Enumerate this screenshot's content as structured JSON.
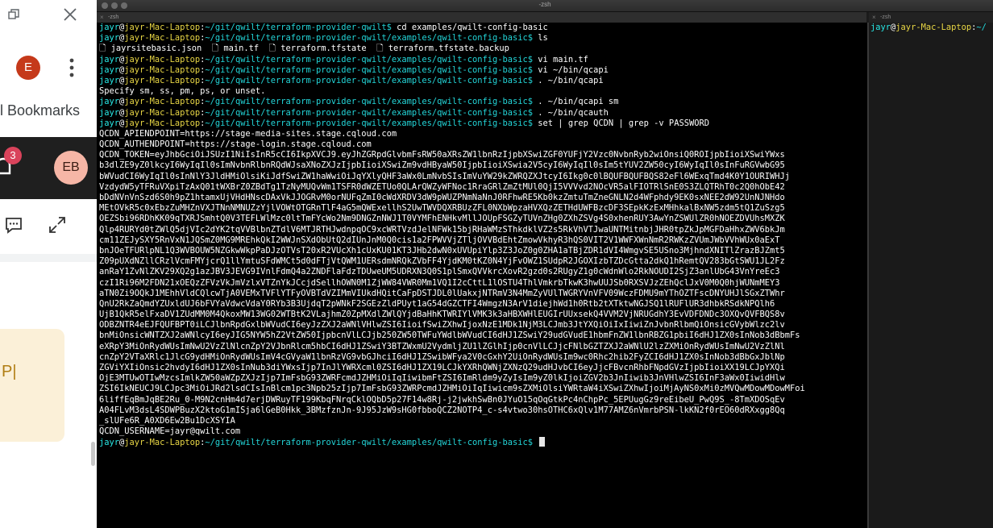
{
  "browser": {
    "avatar_letter": "E",
    "bookmarks_label": "ll Bookmarks",
    "notification_count": "3",
    "profile_initials": "EB",
    "notice_fragment": "P|"
  },
  "terminal": {
    "window_title": "-zsh",
    "tabs": [
      "-zsh",
      "-zsh"
    ],
    "prompt": {
      "user": "jayr",
      "at": "@",
      "host": "jayr-Mac-Laptop",
      "colon": ":"
    },
    "lines": [
      {
        "kind": "prompt",
        "path": "~/git/qwilt/terraform-provider-qwilt$",
        "cmd": " cd examples/qwilt-config-basic"
      },
      {
        "kind": "prompt",
        "path": "~/git/qwilt/terraform-provider-qwilt/examples/qwilt-config-basic$",
        "cmd": " ls"
      },
      {
        "kind": "out",
        "text": "🗋 jayrsitebasic.json  🗋 main.tf  🗋 terraform.tfstate  🗋 terraform.tfstate.backup"
      },
      {
        "kind": "prompt",
        "path": "~/git/qwilt/terraform-provider-qwilt/examples/qwilt-config-basic$",
        "cmd": " vi main.tf"
      },
      {
        "kind": "prompt",
        "path": "~/git/qwilt/terraform-provider-qwilt/examples/qwilt-config-basic$",
        "cmd": " vi ~/bin/qcapi"
      },
      {
        "kind": "prompt",
        "path": "~/git/qwilt/terraform-provider-qwilt/examples/qwilt-config-basic$",
        "cmd": " . ~/bin/qcapi"
      },
      {
        "kind": "out",
        "text": "Specify sm, ss, pm, ps, or unset."
      },
      {
        "kind": "prompt",
        "path": "~/git/qwilt/terraform-provider-qwilt/examples/qwilt-config-basic$",
        "cmd": " . ~/bin/qcapi sm"
      },
      {
        "kind": "prompt",
        "path": "~/git/qwilt/terraform-provider-qwilt/examples/qwilt-config-basic$",
        "cmd": " . ~/bin/qcauth"
      },
      {
        "kind": "prompt",
        "path": "~/git/qwilt/terraform-provider-qwilt/examples/qwilt-config-basic$",
        "cmd": " set | grep QCDN | grep -v PASSWORD"
      },
      {
        "kind": "out",
        "text": "QCDN_APIENDPOINT=https://stage-media-sites.stage.cqloud.com"
      },
      {
        "kind": "out",
        "text": "QCDN_AUTHENDPOINT=https://stage-login.stage.cqloud.com"
      },
      {
        "kind": "out",
        "text": "QCDN_TOKEN=eyJhbGciOiJSUzI1NiIsInR5cCI6IkpXVCJ9.eyJhZGRpdGlvbmFsRW50aXRsZW1lbnRzIjpbXSwiZGF0YUFjY2Vzc0NvbnRyb2wiOnsiQ0ROIjpbIioiXSwiYWxs"
      },
      {
        "kind": "out",
        "text": "b3dlZE9yZ0lkcyI6WyIqIl0sImNvbnRlbnRQdWJsaXNoZXJzIjpbIioiXSwiZm9vdHByaW50IjpbIioiXSwia2V5cyI6WyIqIl0sIm5tYUV2ZW50cyI6WyIqIl0sInFuRGVwbG95"
      },
      {
        "kind": "out",
        "text": "bWVudCI6WyIqIl0sInNlY3JldHMiOlsiKiJdfSwiZW1haWwiOiJqYXlyQHF3aWx0LmNvbSIsImVuYW29kZWRQZXJtcyI6Ikg0c0lBQUFBQUFBQS82eFl6WExqTmd4K0Y1OURIWHJj"
      },
      {
        "kind": "out",
        "text": "VzdydW5yTFRuVXpiTzAxQ01tWXBrZ0ZBdTg1TzNyMUQvWm1TSFR0dWZETUo0QLArQWZyWFNoc1RraGRlZmZtMUl0QjI5VVVvd2NOcVR5alFIOTRlSnE0S3ZLQTRhT0c2Q0hObE42"
      },
      {
        "kind": "out",
        "text": "bDdNVnVnSzd6S0h9pZ1htamxUjVHdHNscDAxVkJJOGRvM0orNUFqZmI0cWdXRDV3dW9pWUZPNmNaNnJ0RFhwRE5Kb0kzZmtuTmZneGNLN2d4WFphdy9EK0sxNEE2dW92UnNJNHdo"
      },
      {
        "kind": "out",
        "text": "MEtOVkR5c0xEbzZuMHZnVXJTNnNMNUZzYjlVOWtOTGRnTlF4aG5mQWExellhS2UwTWVDQXRBUzZFL0NXbWpzaHVXQzZETHdUWFBzcDF3SEpkKzExMHhkalBxNW5zdm5tQ1ZuSzg5"
      },
      {
        "kind": "out",
        "text": "OEZSbi96RDhKK09qTXRJSmhtQ0V3TEFLWlMzc0ltTmFYcWo2Nm9DNGZnNWJ1T0VYMFhENHkvMllJOUpFSGZyTUVnZHg0ZXhZSVg4S0xhenRUY3AwYnZSWUlZR0hNOEZDVUhsMXZK"
      },
      {
        "kind": "out",
        "text": "Qlp4RURYd0tZWlQ5djVIc2dYK2tqVVBlbnZTdlV6MTJRTHJwdnpqOC9xcWRTVzdJelNFWk15bjRHaWMzSThkdklVZ2s5RkVhVTJwaUNTMitnbjJHR0tpZkJpMGFDaHhxZWV6bkJm"
      },
      {
        "kind": "out",
        "text": "cm11ZEJySXY5RnVxN1JQSmZ0MG9MREhkQkI2WWJnSXdObUtQ2dIUnJnM0Q0cis1a2FPWVVjZTljOVVBdEhtZmowVkhyR3hQS0VIT2V1WWFXWnNmR2RWKzZVUmJWbVVhWUx0aExT"
      },
      {
        "kind": "out",
        "text": "bnJOeTFURlpNL1Q3WVBOUW5NZGkwWkpPaDJzOTVsT20xR2VUcXh1cUxKU01KT3JHb2dwN0xUVUpiYlp3Z3JoZ0g0ZHA1aTBjZDR1dVI4WmgvSE5USno3MjhndXNITlZrazBJZmt5"
      },
      {
        "kind": "out",
        "text": "Z09pUXdNZllCRzlVcmFMYjcrQ1llYmtuSFdWMCt5d0dFTjVtQWM1UERsdmNRQkZVbFF4YjdKM0tKZ0N4YjFvOWZ1SUdpR2JGOXIzbTZDcGtta2dkQ1hRemtQV283bGtSWU1JL2Fz"
      },
      {
        "kind": "out",
        "text": "anRaY1ZvNlZKV29XQ2g1azJBV3JEVG9IVnlFdmQ4a2ZNDFlaFdzTDUweUM5UDRXN3Q0S1plSmxQVVkrcXovR2gzd0s2RUgyZ1g0cWdnWlo2RkNOUDI2SjZ3anlUbG43VnYreEc3"
      },
      {
        "kind": "out",
        "text": "czI1Ri96M2FDN21xOEQzZFVzVkJmVzlxVTZnYkJCcjdSellhOWN0M1ZjWW84VWR0Mm1VQ1I2cCttL1lOSTU4ThlVmkrbTkwK3hwUUJSb0RXSVJzZEhQclJxV0M0Q0hjWUNmMEY3"
      },
      {
        "kind": "out",
        "text": "aTN0Zi9OQkJ1MEhhVldCQlcwTjA0VEMxTVFlYTFyOVBTdVZIMmVIUkdHQitCaFpDSTJDL0lUakxjNTRmV3N4MmZyVUlTWGRYVnVFV09WczFDMU9mYThOZTFscDNYUHJlSGxZTWhr"
      },
      {
        "kind": "out",
        "text": "QnU2RkZaQmdYZUxldUJ6bFVYaVdwcVdaY0RYb3B3UjdqT2pWNkF2SGEzZldPUyt1aG54dGZCTFI4WmgzN3ArV1diejhWd1h0Rtb2tXTktwNGJSQ1lRUFlUR3dhbkRSdkNPQlh6"
      },
      {
        "kind": "out",
        "text": "UjB1QkR5elFxaDV1ZUdMM0M4QkoxMW13WG02WTBtK2VLajhmZ0ZpMXdlZWlQYjdBaHhKTWRIYlVMK3k3aHBXWHlEUGIrUUxsekQ4VVM2VjNRUGdhY3EvVDFDNDc3OXQvQVFBQS8v"
      },
      {
        "kind": "out",
        "text": "ODBZNTR4eEJFQUFBPT0iLCJlbnRpdGxlbWVudCI6eyJzZXJ2aWNlVHlwZSI6IioifSwiZXhwIjoxNzE1MDk1NjM3LCJmb3JtYXQiOiIxIiwiZnJvbnRlbmQiOnsicGVybWlzc2lv"
      },
      {
        "kind": "out",
        "text": "bnMiOnsicWNTZXJ2aWNlcyI6eyJIG5NYW5hZ2VtZW50IjpbcnVlLCJjb250ZW50TWFuYWdlbWVudCI6dHJ1ZSwiY29udGVudE1hbmFnZW1lbnRBZG1pbiI6dHJ1ZX0sInNob3dBbmFs"
      },
      {
        "kind": "out",
        "text": "eXRpY3MiOnRydWUsImNwU2VzZlNlcnZpY2VJbnRlcm5hbCI6dHJ1ZSwiY3BTZWxmU2VydmljZU1lZGlhIjp0cnVlLCJjcFNlbGZTZXJ2aWNlU2lzZXMiOnRydWUsImNwU2VzZlNl"
      },
      {
        "kind": "out",
        "text": "cnZpY2VTaXRlc1JlcG9ydHMiOnRydWUsImV4cGVyaW1lbnRzVG9vbGJhciI6dHJ1ZSwibWFya2V0cGxhY2UiOnRydWUsIm9wc0Rhc2hib2FyZCI6dHJ1ZX0sInNob3dBbGxJblNp"
      },
      {
        "kind": "out",
        "text": "ZGViYXIiOnsic2hvdyI6dHJ1ZX0sInNub3diYWxsIjp7InJlYWRXcml0ZSI6dHJ1ZX19LCJkYXRhQWNjZXNzQ29udHJvbCI6eyJjcFBvcnRhbFNpdGVzIjpbIioiXX19LCJpYXQi"
      },
      {
        "kind": "out",
        "text": "OjE3MTUwOTIwMzcsImlkZW50aWZpZXJzIjp7ImFsbG93ZWRFcmdJZHMiOiIqIiwibmFtZSI6ImRldm9yZyIsIm9yZ0lkIjoiZGV2b3JnIiwib3JnVHlwZSI6InF3aWx0IiwidHlw"
      },
      {
        "kind": "out",
        "text": "ZSI6IkNEUCJ9LCJpc3MiOiJRd2lsdCIsInBlcm1pc3Npb25zIjp7ImFsbG93ZWRPcmdJZHMiOiIqIiwicm9sZXMiOlsiYWRtaW4iXSwiZXhwIjoiMjAyNS0xMi0zMVQwMDowMDowMFoi"
      },
      {
        "kind": "out",
        "text": "6liffEqBmJqBE2Ru_0-M9N2cnHm4d7erjDWRuyTF199KbqFNrqCklOQbD5p27F14w8Rj-j2jwkhSwBn0JYuO15qOqGtkPc4nChpPc_5EPUugGz9reEibeU_PwQ9S_-8TmXDOSqEv"
      },
      {
        "kind": "out",
        "text": "A04FLvM3dsL4SDWPBuzX2ktoG1mISja6lGeB0Hkk_3BMzfznJn-9J95JzW9sHG0fbboQCZ2NOTP4_c-s4vtwo30hsOTHC6xQlv1M77AMZ6nVmrbPSN-lkKN2f0rEO60dRXxgg8Qq"
      },
      {
        "kind": "out",
        "text": "_slUFe6R_A0XD6Ew2Bu1DcXSYIA"
      },
      {
        "kind": "out",
        "text": "QCDN_USERNAME=jayr@qwilt.com"
      },
      {
        "kind": "prompt",
        "path": "~/git/qwilt/terraform-provider-qwilt/examples/qwilt-config-basic$",
        "cmd": " ",
        "cursor": true
      }
    ],
    "right_pane_path": "~/"
  }
}
